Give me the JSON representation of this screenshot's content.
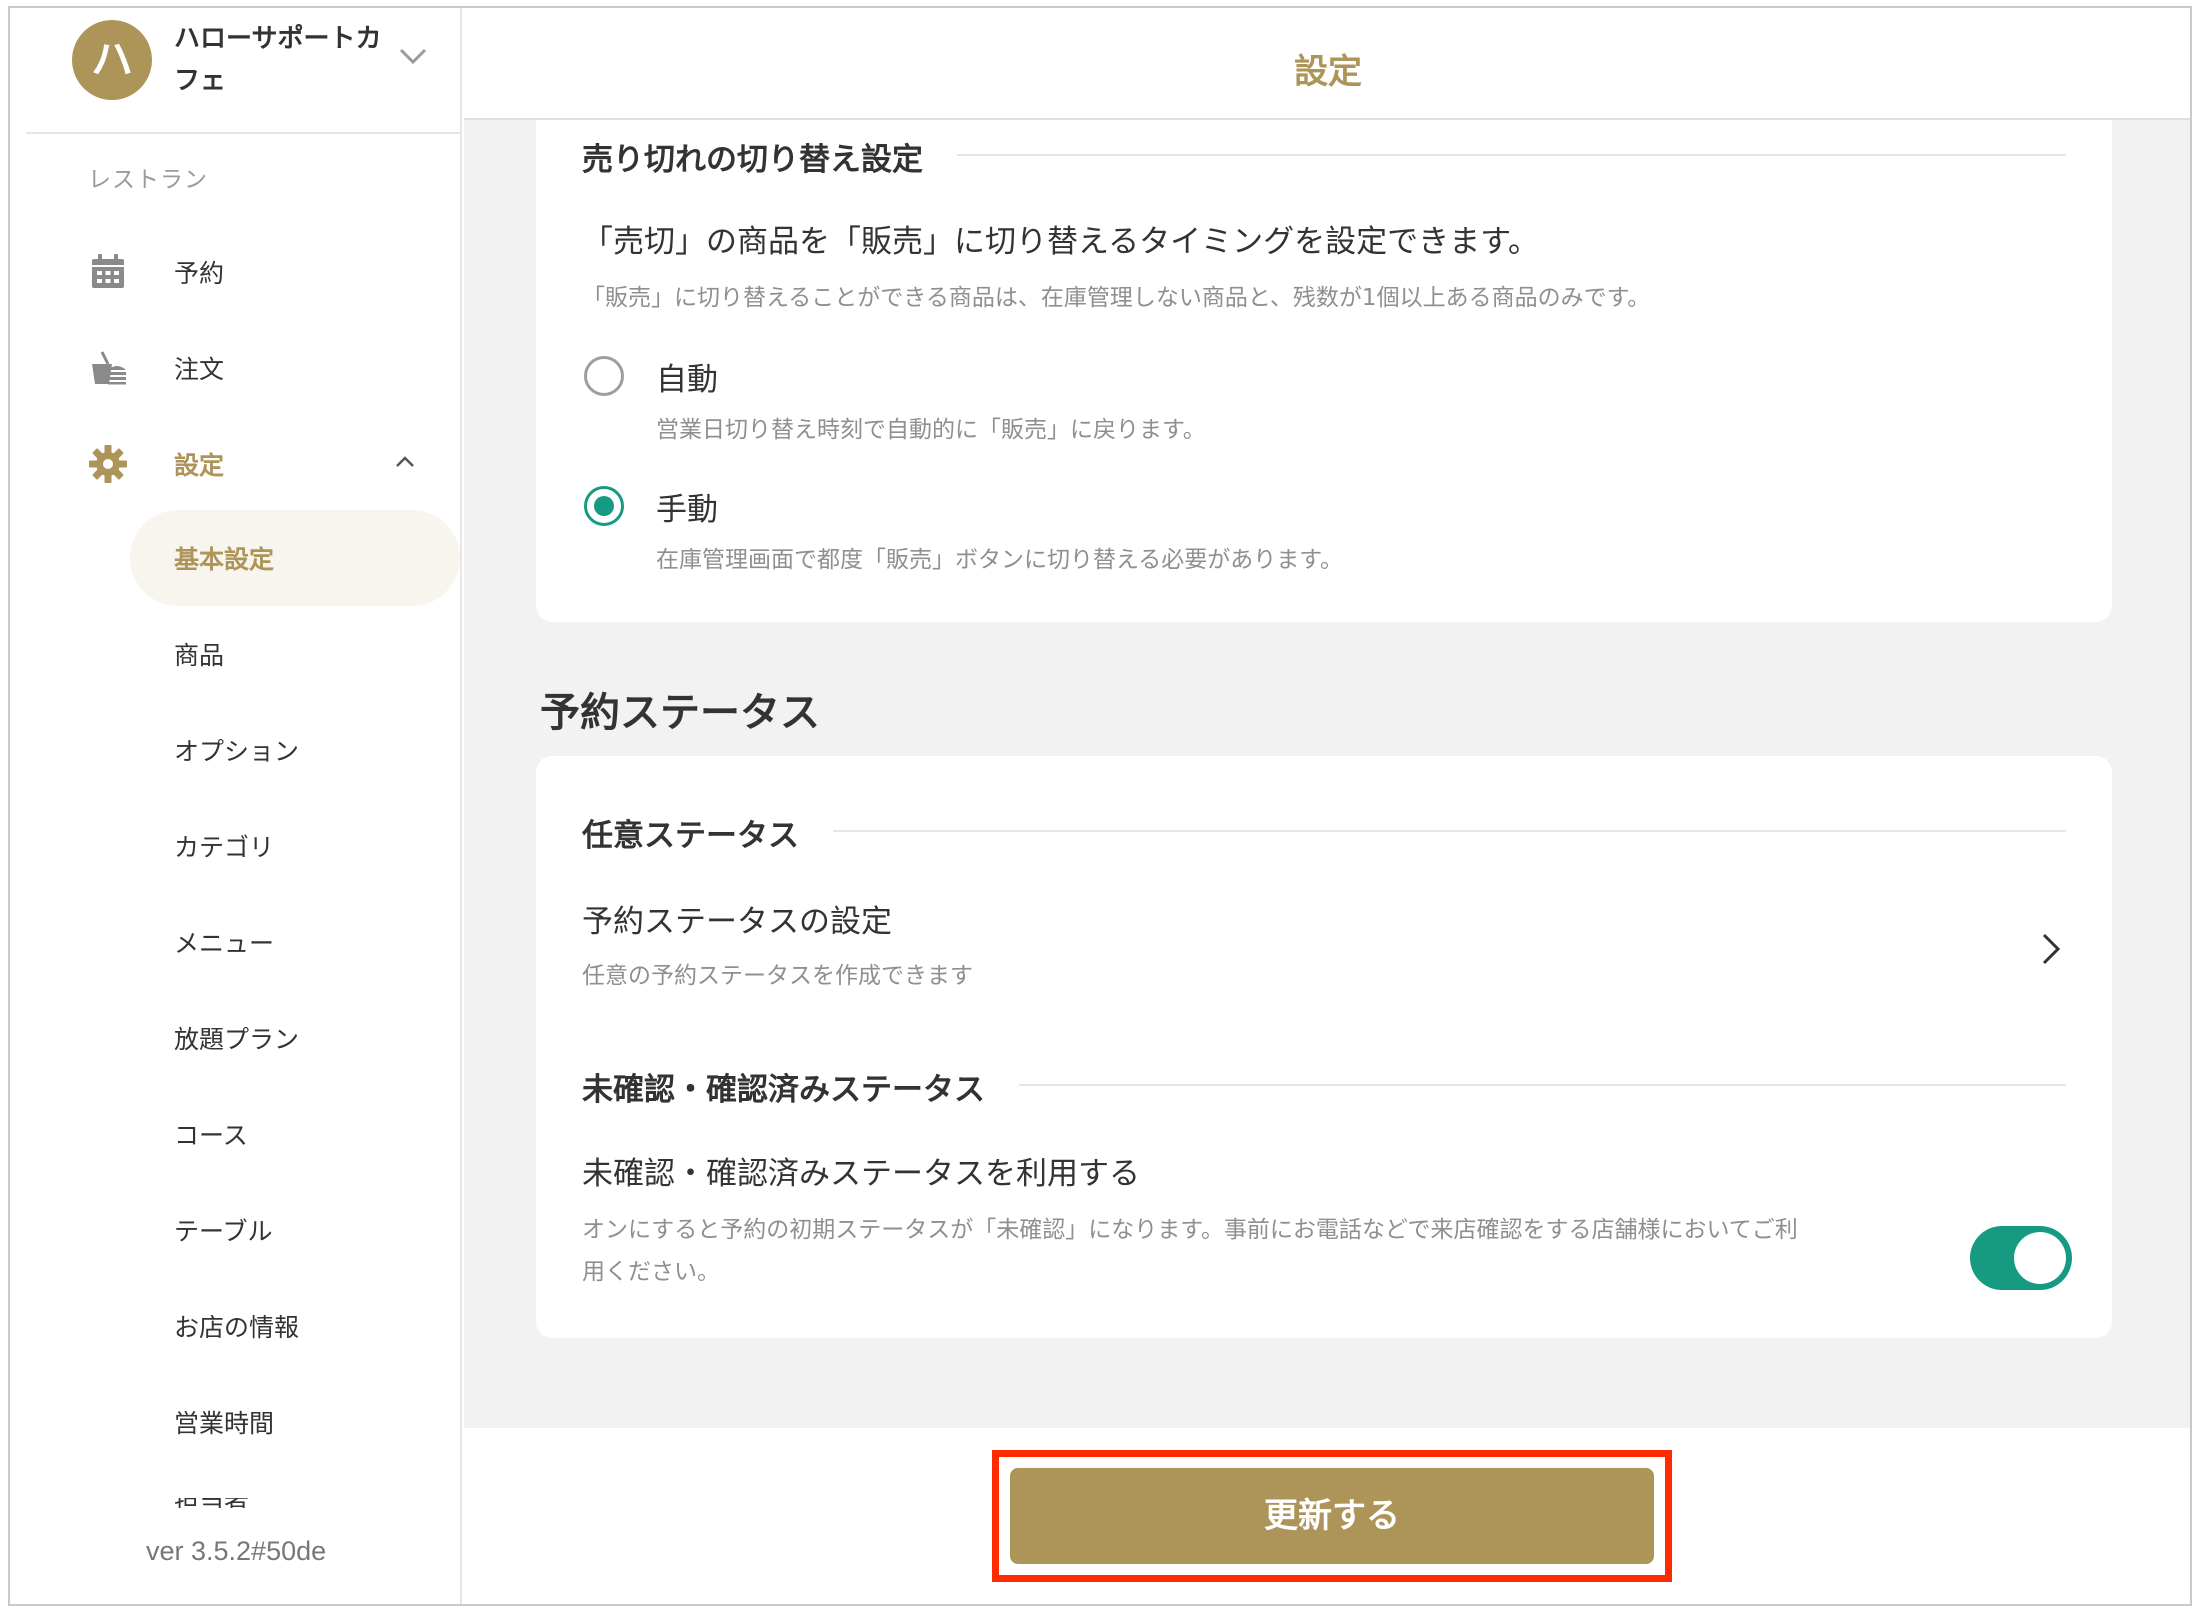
{
  "account": {
    "initial": "ハ",
    "name": "ハローサポートカフェ"
  },
  "sidebar": {
    "section_label": "レストラン",
    "items": [
      {
        "label": "予約",
        "icon": "calendar-icon"
      },
      {
        "label": "注文",
        "icon": "food-order-icon"
      },
      {
        "label": "設定",
        "icon": "gear-icon",
        "active": true
      }
    ],
    "sub_items": [
      {
        "label": "基本設定",
        "active": true
      },
      {
        "label": "商品"
      },
      {
        "label": "オプション"
      },
      {
        "label": "カテゴリ"
      },
      {
        "label": "メニュー"
      },
      {
        "label": "放題プラン"
      },
      {
        "label": "コース"
      },
      {
        "label": "テーブル"
      },
      {
        "label": "お店の情報"
      },
      {
        "label": "営業時間"
      },
      {
        "label": "担当者"
      }
    ],
    "version": "ver 3.5.2#50de"
  },
  "header": {
    "title": "設定"
  },
  "soldout": {
    "heading": "売り切れの切り替え設定",
    "lead": "「売切」の商品を「販売」に切り替えるタイミングを設定できます。",
    "note": "「販売」に切り替えることができる商品は、在庫管理しない商品と、残数が1個以上ある商品のみです。",
    "options": [
      {
        "label": "自動",
        "note": "営業日切り替え時刻で自動的に「販売」に戻ります。",
        "checked": false
      },
      {
        "label": "手動",
        "note": "在庫管理画面で都度「販売」ボタンに切り替える必要があります。",
        "checked": true
      }
    ]
  },
  "reservation_status": {
    "title": "予約ステータス",
    "optional": {
      "heading": "任意ステータス",
      "row_title": "予約ステータスの設定",
      "row_note": "任意の予約ステータスを作成できます"
    },
    "confirm": {
      "heading": "未確認・確認済みステータス",
      "row_title": "未確認・確認済みステータスを利用する",
      "row_note_line1": "オンにすると予約の初期ステータスが「未確認」になります。事前にお電話などで来店確認をする店舗様においてご利",
      "row_note_line2": "用ください。",
      "enabled": true
    }
  },
  "footer": {
    "update_label": "更新する"
  },
  "colors": {
    "brand": "#ad955a",
    "accent": "#169b82",
    "highlight": "#ff2a00"
  }
}
